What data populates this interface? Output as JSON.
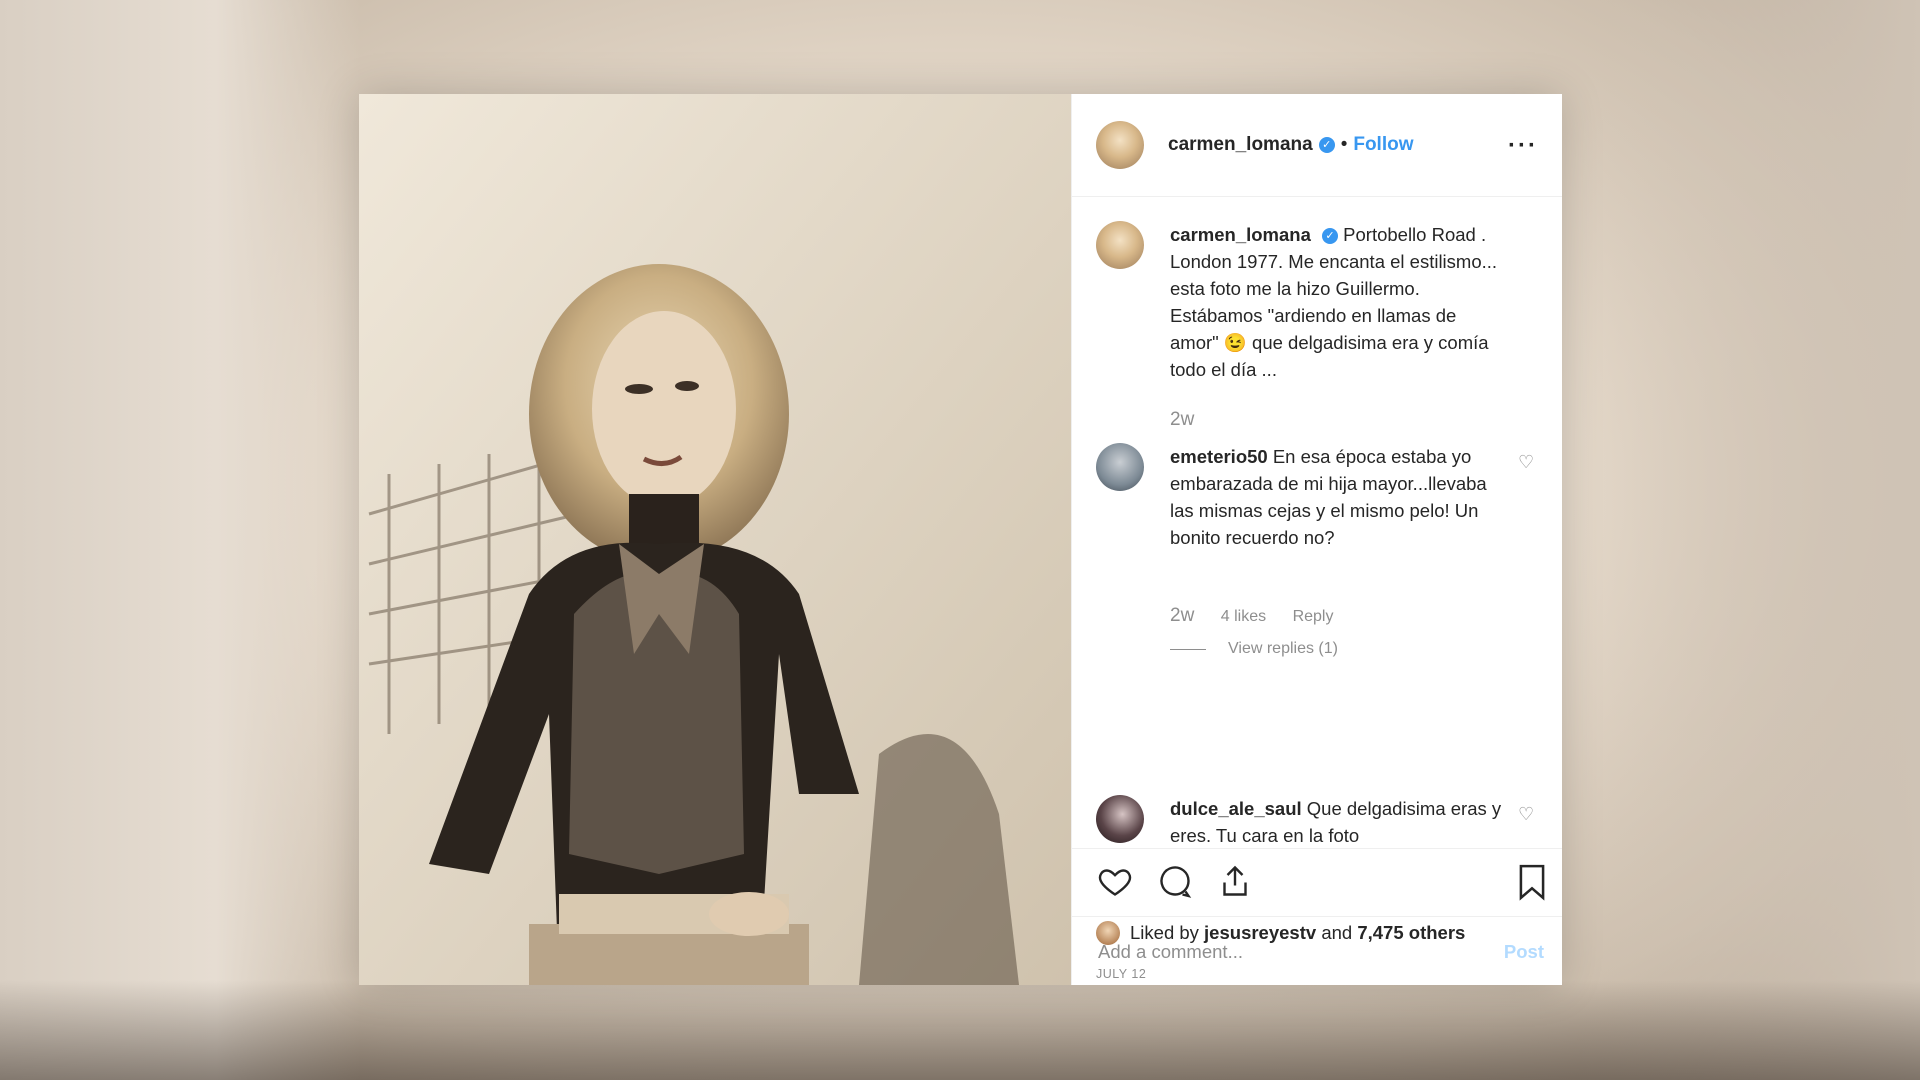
{
  "post": {
    "username": "carmen_lomana",
    "follow_label": "Follow",
    "more_label": "···",
    "caption": {
      "username": "carmen_lomana",
      "text": "Portobello Road . London 1977. Me encanta el estilismo... esta foto me la hizo Guillermo. Estábamos \"ardiendo en llamas de amor\" 😉 que delgadisima era y comía todo el día ...",
      "time": "2w"
    },
    "comments": [
      {
        "username": "emeterio50",
        "text": "En esa época estaba yo embarazada de mi hija mayor...llevaba las mismas cejas y el mismo pelo! Un bonito recuerdo no?",
        "time": "2w",
        "likes": "4 likes",
        "reply_label": "Reply",
        "view_replies": "View replies (1)"
      },
      {
        "username": "dulce_ale_saul",
        "text": "Que delgadisima eras y eres. Tu cara en la foto"
      }
    ],
    "liked_by_prefix": "Liked by",
    "liked_by_user": "jesusreyestv",
    "liked_by_and": "and",
    "liked_by_others": "7,475 others",
    "date": "JULY 12",
    "add_comment_placeholder": "Add a comment...",
    "post_button": "Post"
  },
  "colors": {
    "accent": "#3897f0",
    "text": "#262626",
    "muted": "#8e8e8e"
  },
  "icons": [
    "heart-icon",
    "comment-icon",
    "share-icon",
    "bookmark-icon",
    "verified-icon",
    "more-icon"
  ]
}
